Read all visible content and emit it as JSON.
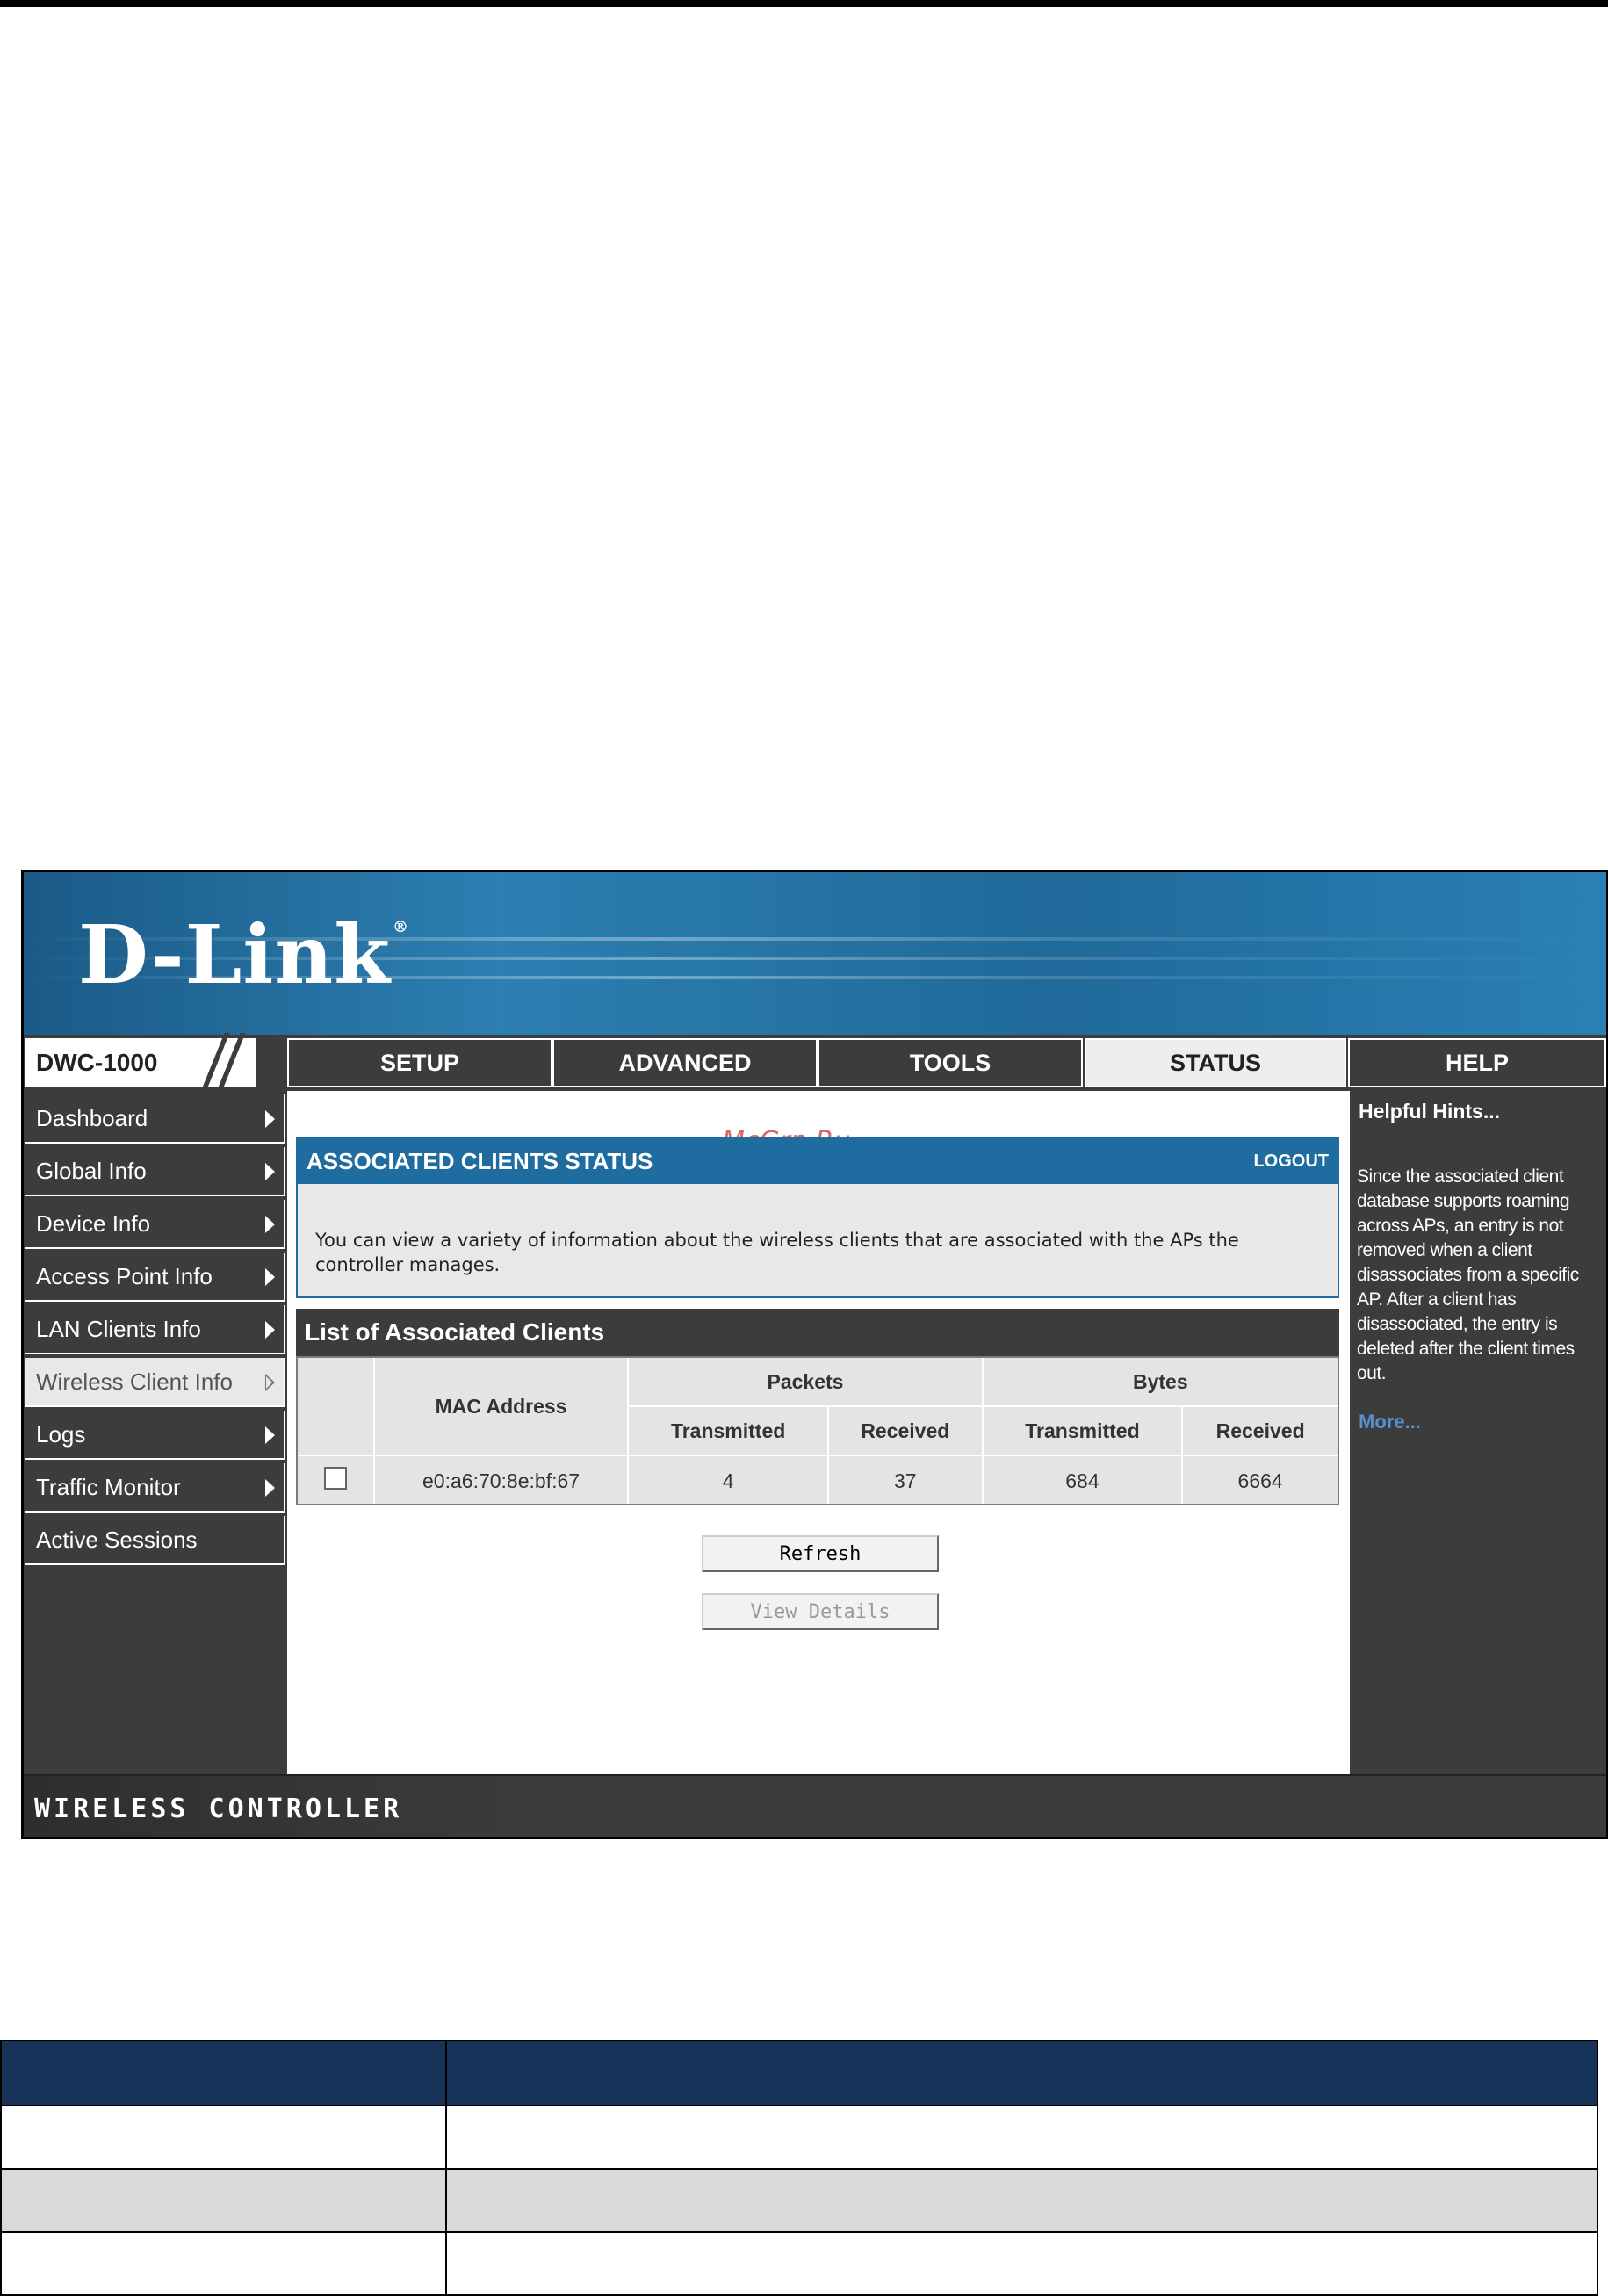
{
  "app": {
    "brand": "D-Link",
    "model": "DWC-1000",
    "footer_label": "WIRELESS CONTROLLER"
  },
  "tabs": [
    {
      "label": "SETUP",
      "active": false
    },
    {
      "label": "ADVANCED",
      "active": false
    },
    {
      "label": "TOOLS",
      "active": false
    },
    {
      "label": "STATUS",
      "active": true
    },
    {
      "label": "HELP",
      "active": false
    }
  ],
  "sidebar": {
    "items": [
      {
        "label": "Dashboard",
        "arrow": true
      },
      {
        "label": "Global Info",
        "arrow": true
      },
      {
        "label": "Device Info",
        "arrow": true
      },
      {
        "label": "Access Point Info",
        "arrow": true
      },
      {
        "label": "LAN Clients Info",
        "arrow": true
      },
      {
        "label": "Wireless Client Info",
        "arrow": true,
        "active": true
      },
      {
        "label": "Logs",
        "arrow": true
      },
      {
        "label": "Traffic Monitor",
        "arrow": true
      },
      {
        "label": "Active Sessions",
        "arrow": false
      }
    ]
  },
  "watermark": "McGrp.Ru",
  "status_box": {
    "title": "ASSOCIATED CLIENTS STATUS",
    "logout": "LOGOUT",
    "description": "You can view a variety of information about the wireless clients that are associated with the APs the controller manages."
  },
  "clients_table": {
    "title": "List of Associated Clients",
    "headers": {
      "mac": "MAC Address",
      "packets": "Packets",
      "bytes": "Bytes",
      "transmitted": "Transmitted",
      "received": "Received"
    },
    "rows": [
      {
        "mac": "e0:a6:70:8e:bf:67",
        "packets_tx": "4",
        "packets_rx": "37",
        "bytes_tx": "684",
        "bytes_rx": "6664"
      }
    ]
  },
  "buttons": {
    "refresh": "Refresh",
    "view_details": "View Details"
  },
  "help": {
    "title": "Helpful Hints...",
    "body": "Since the associated client database supports roaming across APs, an entry is not removed when a client disassociates from a specific AP. After a client has disassociated, the entry is deleted after the client times out.",
    "more": "More..."
  }
}
